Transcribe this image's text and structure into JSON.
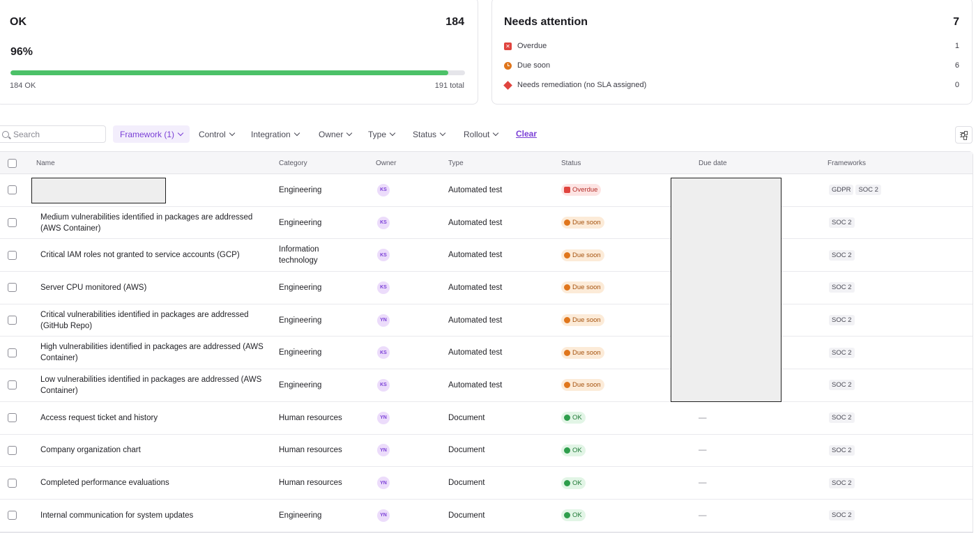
{
  "ok_card": {
    "title": "OK",
    "count": "184",
    "percent": "96%",
    "progress_fraction": 0.9634,
    "ok_label": "184 OK",
    "total_label": "191 total"
  },
  "attention_card": {
    "title": "Needs attention",
    "count": "7",
    "items": [
      {
        "label": "Overdue",
        "count": "1",
        "icon": "overdue-icon"
      },
      {
        "label": "Due soon",
        "count": "6",
        "icon": "due-soon-icon"
      },
      {
        "label": "Needs remediation (no SLA assigned)",
        "count": "0",
        "icon": "remediation-icon"
      }
    ]
  },
  "toolbar": {
    "search_placeholder": "Search",
    "filters": {
      "framework": "Framework (1)",
      "control": "Control",
      "integration": "Integration",
      "owner": "Owner",
      "type": "Type",
      "status": "Status",
      "rollout": "Rollout"
    },
    "clear_label": "Clear"
  },
  "table": {
    "headers": {
      "name": "Name",
      "category": "Category",
      "owner": "Owner",
      "type": "Type",
      "status": "Status",
      "due_date": "Due date",
      "frameworks": "Frameworks"
    },
    "rows": [
      {
        "name": "",
        "category": "Engineering",
        "owner": "KS",
        "type": "Automated test",
        "status": "Overdue",
        "status_kind": "overdue",
        "due": "",
        "frameworks": [
          "GDPR",
          "SOC 2"
        ]
      },
      {
        "name": "Medium vulnerabilities identified in packages are addressed (AWS Container)",
        "category": "Engineering",
        "owner": "KS",
        "type": "Automated test",
        "status": "Due soon",
        "status_kind": "due",
        "due": "",
        "frameworks": [
          "SOC 2"
        ]
      },
      {
        "name": "Critical IAM roles not granted to service accounts (GCP)",
        "category": "Information technology",
        "owner": "KS",
        "type": "Automated test",
        "status": "Due soon",
        "status_kind": "due",
        "due": "",
        "frameworks": [
          "SOC 2"
        ]
      },
      {
        "name": "Server CPU monitored (AWS)",
        "category": "Engineering",
        "owner": "KS",
        "type": "Automated test",
        "status": "Due soon",
        "status_kind": "due",
        "due": "",
        "frameworks": [
          "SOC 2"
        ]
      },
      {
        "name": "Critical vulnerabilities identified in packages are addressed (GitHub Repo)",
        "category": "Engineering",
        "owner": "YN",
        "type": "Automated test",
        "status": "Due soon",
        "status_kind": "due",
        "due": "",
        "frameworks": [
          "SOC 2"
        ]
      },
      {
        "name": "High vulnerabilities identified in packages are addressed (AWS Container)",
        "category": "Engineering",
        "owner": "KS",
        "type": "Automated test",
        "status": "Due soon",
        "status_kind": "due",
        "due": "",
        "frameworks": [
          "SOC 2"
        ]
      },
      {
        "name": "Low vulnerabilities identified in packages are addressed (AWS Container)",
        "category": "Engineering",
        "owner": "KS",
        "type": "Automated test",
        "status": "Due soon",
        "status_kind": "due",
        "due": "",
        "frameworks": [
          "SOC 2"
        ]
      },
      {
        "name": "Access request ticket and history",
        "category": "Human resources",
        "owner": "YN",
        "type": "Document",
        "status": "OK",
        "status_kind": "ok",
        "due": "—",
        "frameworks": [
          "SOC 2"
        ]
      },
      {
        "name": "Company organization chart",
        "category": "Human resources",
        "owner": "YN",
        "type": "Document",
        "status": "OK",
        "status_kind": "ok",
        "due": "—",
        "frameworks": [
          "SOC 2"
        ]
      },
      {
        "name": "Completed performance evaluations",
        "category": "Human resources",
        "owner": "YN",
        "type": "Document",
        "status": "OK",
        "status_kind": "ok",
        "due": "—",
        "frameworks": [
          "SOC 2"
        ]
      },
      {
        "name": "Internal communication for system updates",
        "category": "Engineering",
        "owner": "YN",
        "type": "Document",
        "status": "OK",
        "status_kind": "ok",
        "due": "—",
        "frameworks": [
          "SOC 2"
        ]
      }
    ]
  },
  "colors": {
    "accent": "#7a3fd6",
    "ok": "#4cc168",
    "overdue": "#e0443e",
    "due_soon": "#e0761c"
  }
}
